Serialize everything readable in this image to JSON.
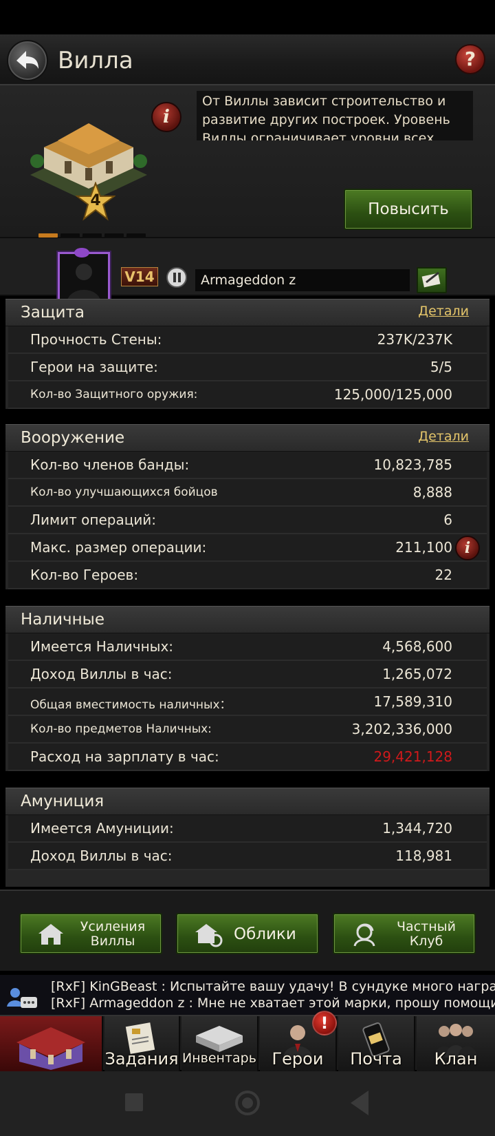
{
  "header": {
    "title": "Вилла",
    "help_label": "?"
  },
  "villa": {
    "level": "4",
    "description": "От Виллы зависит строительство и развитие других построек. Уровень Виллы ограничивает уровни всех",
    "upgrade_label": "Повысить",
    "info_label": "i",
    "page_count": 5,
    "active_page": 1
  },
  "profile": {
    "vip": "V14",
    "name": "Armageddon  z"
  },
  "sections": {
    "defense": {
      "title": "Защита",
      "details_label": "Детали",
      "rows": [
        {
          "label": "Прочность Стены:",
          "value": "237K/237K"
        },
        {
          "label": "Герои на защите:",
          "value": "5/5"
        },
        {
          "label": "Кол-во Защитного оружия:",
          "value": "125,000/125,000"
        }
      ]
    },
    "armament": {
      "title": "Вооружение",
      "details_label": "Детали",
      "rows": [
        {
          "label": "Кол-во членов банды:",
          "value": "10,823,785"
        },
        {
          "label": "Кол-во улучшающихся бойцов",
          "value": "8,888"
        },
        {
          "label": "Лимит операций:",
          "value": "6"
        },
        {
          "label": "Макс. размер операции:",
          "value": "211,100"
        },
        {
          "label": "Кол-во Героев:",
          "value": "22"
        }
      ]
    },
    "cash": {
      "title": "Наличные",
      "rows": [
        {
          "label": "Имеется Наличных:",
          "value": "4,568,600"
        },
        {
          "label": "Доход Виллы в час:",
          "value": "1,265,072"
        },
        {
          "label": "Общая вместимость наличных：",
          "value": "17,589,310"
        },
        {
          "label": "Кол-во предметов Наличных:",
          "value": "3,202,336,000"
        },
        {
          "label": "Расход на зарплату в час:",
          "value": "29,421,128"
        }
      ]
    },
    "ammo": {
      "title": "Амуниция",
      "rows": [
        {
          "label": "Имеется Амуниции:",
          "value": "1,344,720"
        },
        {
          "label": "Доход Виллы в час:",
          "value": "118,981"
        }
      ]
    }
  },
  "actions": {
    "boosts": "Усиления Виллы",
    "skins": "Облики",
    "club": "Частный Клуб"
  },
  "chat": {
    "lines": [
      "[RxF] KinGBeast : Испытайте вашу удачу! В сундуке много наград!",
      "[RxF] Armageddon  z : Мне не хватает этой марки, прошу помощи у"
    ]
  },
  "nav": {
    "tasks": "Задания",
    "inventory": "Инвентарь",
    "heroes": "Герои",
    "mail": "Почта",
    "clan": "Клан",
    "alert": "!"
  },
  "colors": {
    "accent_green": "#2c5012",
    "link_gold": "#e4c56a",
    "negative_red": "#d0191b"
  }
}
